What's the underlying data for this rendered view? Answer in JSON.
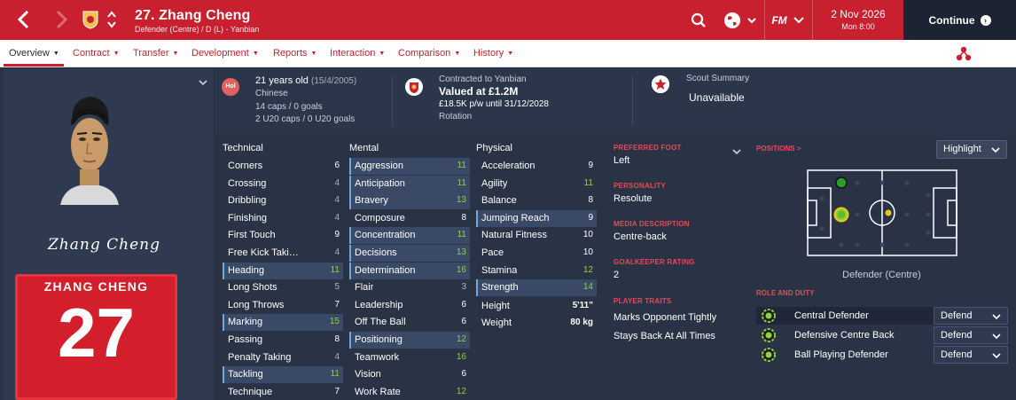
{
  "header": {
    "title": "27. Zhang Cheng",
    "subtitle": "Defender (Centre) / D (L) - Yanbian",
    "date": "2 Nov 2026",
    "time": "Mon 8:00",
    "continue_label": "Continue",
    "fm_label": "FM",
    "accent": "#c8202e"
  },
  "tabs": [
    {
      "label": "Overview"
    },
    {
      "label": "Contract"
    },
    {
      "label": "Transfer"
    },
    {
      "label": "Development"
    },
    {
      "label": "Reports"
    },
    {
      "label": "Interaction"
    },
    {
      "label": "Comparison"
    },
    {
      "label": "History"
    }
  ],
  "player": {
    "signature": "Zhang Cheng",
    "shirt_name": "ZHANG CHENG",
    "shirt_number": "27"
  },
  "info": {
    "nationality_code": "Hol",
    "age": "21 years old",
    "dob": "(15/4/2005)",
    "nationality": "Chinese",
    "caps": "14 caps / 0 goals",
    "u20_caps": "2 U20 caps / 0 U20 goals",
    "contract_title": "Contracted to Yanbian",
    "value": "Valued at £1.2M",
    "wage": "£18.5K p/w until 31/12/2028",
    "squad_status": "Rotation",
    "scout_title": "Scout Summary",
    "scout_value": "Unavailable"
  },
  "attributes": {
    "technical_title": "Technical",
    "mental_title": "Mental",
    "physical_title": "Physical",
    "technical": [
      {
        "name": "Corners",
        "value": "6"
      },
      {
        "name": "Crossing",
        "value": "4"
      },
      {
        "name": "Dribbling",
        "value": "4"
      },
      {
        "name": "Finishing",
        "value": "4"
      },
      {
        "name": "First Touch",
        "value": "9"
      },
      {
        "name": "Free Kick Taki…",
        "value": "4"
      },
      {
        "name": "Heading",
        "value": "11"
      },
      {
        "name": "Long Shots",
        "value": "5"
      },
      {
        "name": "Long Throws",
        "value": "7"
      },
      {
        "name": "Marking",
        "value": "15"
      },
      {
        "name": "Passing",
        "value": "8"
      },
      {
        "name": "Penalty Taking",
        "value": "4"
      },
      {
        "name": "Tackling",
        "value": "11"
      },
      {
        "name": "Technique",
        "value": "7"
      }
    ],
    "mental": [
      {
        "name": "Aggression",
        "value": "11"
      },
      {
        "name": "Anticipation",
        "value": "11"
      },
      {
        "name": "Bravery",
        "value": "13"
      },
      {
        "name": "Composure",
        "value": "8"
      },
      {
        "name": "Concentration",
        "value": "11"
      },
      {
        "name": "Decisions",
        "value": "13"
      },
      {
        "name": "Determination",
        "value": "16"
      },
      {
        "name": "Flair",
        "value": "3"
      },
      {
        "name": "Leadership",
        "value": "6"
      },
      {
        "name": "Off The Ball",
        "value": "6"
      },
      {
        "name": "Positioning",
        "value": "12"
      },
      {
        "name": "Teamwork",
        "value": "16"
      },
      {
        "name": "Vision",
        "value": "6"
      },
      {
        "name": "Work Rate",
        "value": "12"
      }
    ],
    "physical": [
      {
        "name": "Acceleration",
        "value": "9"
      },
      {
        "name": "Agility",
        "value": "11"
      },
      {
        "name": "Balance",
        "value": "8"
      },
      {
        "name": "Jumping Reach",
        "value": "9"
      },
      {
        "name": "Natural Fitness",
        "value": "10"
      },
      {
        "name": "Pace",
        "value": "10"
      },
      {
        "name": "Stamina",
        "value": "12"
      },
      {
        "name": "Strength",
        "value": "14"
      }
    ],
    "height_label": "Height",
    "height": "5'11\"",
    "weight_label": "Weight",
    "weight": "80 kg"
  },
  "details": {
    "preferred_foot_label": "PREFERRED FOOT",
    "preferred_foot": "Left",
    "personality_label": "PERSONALITY",
    "personality": "Resolute",
    "media_label": "MEDIA DESCRIPTION",
    "media": "Centre-back",
    "gk_label": "GOALKEEPER RATING",
    "gk": "2",
    "traits_label": "PLAYER TRAITS",
    "traits": [
      "Marks Opponent Tightly",
      "Stays Back At All Times"
    ]
  },
  "positions": {
    "title": "POSITIONS >",
    "dropdown": "Highlight",
    "position_name": "Defender (Centre)",
    "role_title": "ROLE AND DUTY",
    "roles": [
      {
        "name": "Central Defender",
        "duty": "Defend"
      },
      {
        "name": "Defensive Centre Back",
        "duty": "Defend"
      },
      {
        "name": "Ball Playing Defender",
        "duty": "Defend"
      }
    ]
  },
  "colors": {
    "green": "#8fd13f",
    "red": "#e44b56"
  }
}
